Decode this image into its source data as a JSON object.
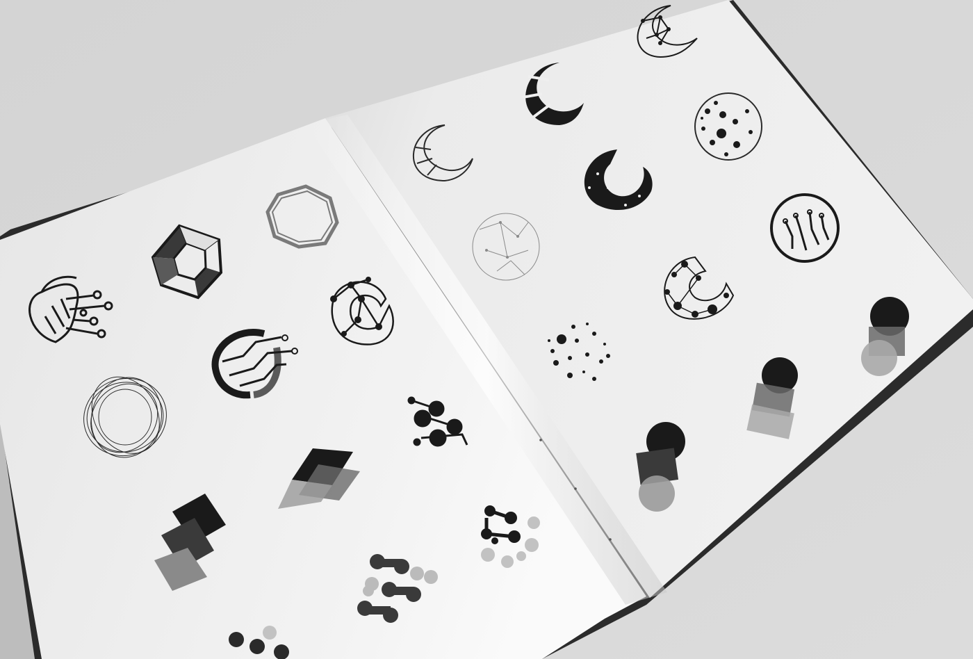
{
  "scene": {
    "subject": "open-sketchbook-logo-sketches",
    "colors": {
      "background": "#d6d6d6",
      "page": "#efefef",
      "ink": "#1a1a1a",
      "ink_mid": "#5a5a5a",
      "ink_light": "#9a9a9a",
      "cover": "#2b2b2b"
    },
    "icons": [
      "shrimp-circuit-icon",
      "hexagon-facet-icon",
      "octagon-ring-icon",
      "circuit-c-icon",
      "network-crescent-icon",
      "wave-ring-icon",
      "molecule-dots-icon",
      "layered-rhombus-icon",
      "stacked-squares-icon",
      "bracket-dots-icon",
      "capsule-dots-icon",
      "crescent-outline-icon",
      "crescent-solid-icon",
      "crescent-network-icon",
      "dotted-sphere-icon",
      "night-ring-icon",
      "network-sphere-icon",
      "circuit-circle-icon",
      "dotted-globe-icon",
      "overlap-circles-icon"
    ]
  }
}
